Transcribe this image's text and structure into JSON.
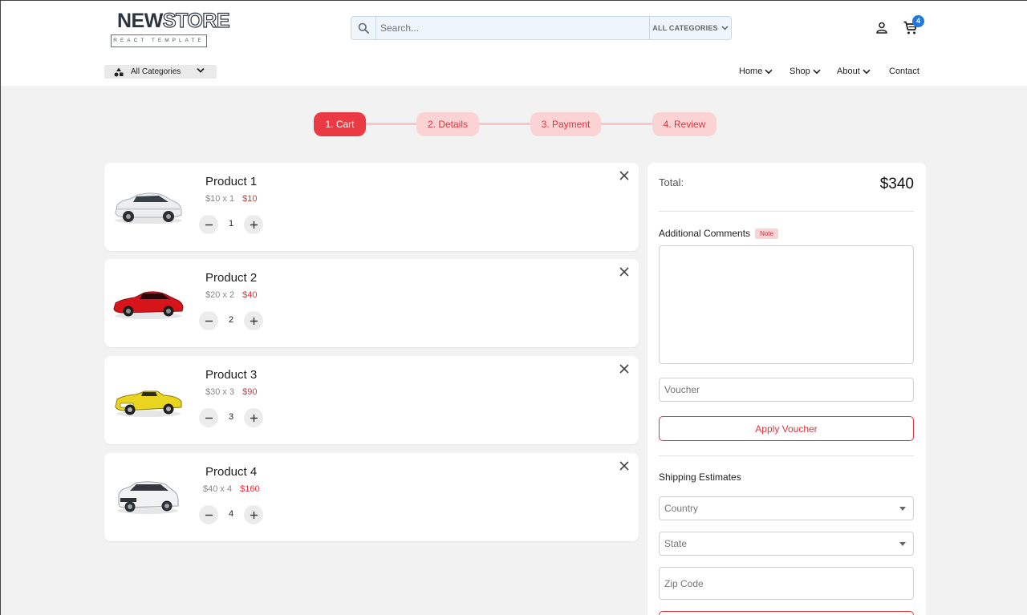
{
  "colors": {
    "accent": "#e0343e",
    "accent_light": "#fcd3d5",
    "badge": "#1e78d8"
  },
  "logo": {
    "line1_a": "NEW",
    "line1_b": "STORE",
    "line2": "REACT TEMPLATE"
  },
  "search": {
    "placeholder": "Search...",
    "category": "ALL CATEGORIES"
  },
  "cart": {
    "count": "4"
  },
  "categories_button": {
    "label": "All Categories"
  },
  "nav": {
    "home": "Home",
    "shop": "Shop",
    "about": "About",
    "contact": "Contact"
  },
  "steps": [
    {
      "label": "1. Cart"
    },
    {
      "label": "2. Details"
    },
    {
      "label": "3. Payment"
    },
    {
      "label": "4. Review"
    }
  ],
  "items": [
    {
      "name": "Product 1",
      "unit": "$10 x 1",
      "subtotal": "$10",
      "qty": "1",
      "car": "white-suv"
    },
    {
      "name": "Product 2",
      "unit": "$20 x 2",
      "subtotal": "$40",
      "qty": "2",
      "car": "red-coupe"
    },
    {
      "name": "Product 3",
      "unit": "$30 x 3",
      "subtotal": "$90",
      "qty": "3",
      "car": "yellow-convertible"
    },
    {
      "name": "Product 4",
      "unit": "$40 x 4",
      "subtotal": "$160",
      "qty": "4",
      "car": "white-suv-compact"
    }
  ],
  "summary": {
    "total_label": "Total:",
    "total_value": "$340",
    "comments_label": "Additional Comments",
    "note_badge": "Note",
    "voucher_placeholder": "Voucher",
    "apply_label": "Apply Voucher",
    "shipping_label": "Shipping Estimates",
    "country_placeholder": "Country",
    "state_placeholder": "State",
    "zip_placeholder": "Zip Code"
  }
}
